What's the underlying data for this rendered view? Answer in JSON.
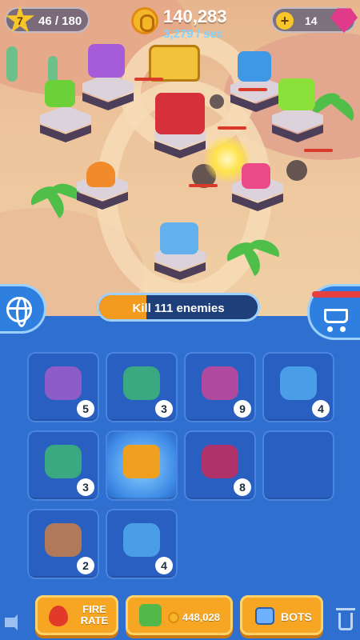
{
  "hud": {
    "level": "7",
    "xp": "46 / 180",
    "coins": "140,283",
    "coin_rate": "3,279 / sec",
    "gems": "14"
  },
  "mission": {
    "label": "Kill 111 enemies",
    "progress": 0.3
  },
  "inventory": [
    {
      "icon": "purple-tank-turret-icon",
      "level": "5",
      "color": "#8e5cc8"
    },
    {
      "icon": "green-cannon-turret-icon",
      "level": "3",
      "color": "#3aa880"
    },
    {
      "icon": "pink-drill-turret-icon",
      "level": "9",
      "color": "#b04aa0"
    },
    {
      "icon": "blue-cannon-turret-icon",
      "level": "4",
      "color": "#4a9ee8"
    },
    {
      "icon": "green-cannon-turret-icon",
      "level": "3",
      "color": "#3aa880"
    },
    {
      "icon": "mystery-crate-icon",
      "level": "",
      "color": "#f0a020"
    },
    {
      "icon": "magenta-twin-turret-icon",
      "level": "8",
      "color": "#b0326a"
    },
    {
      "icon": "",
      "level": "",
      "color": ""
    },
    {
      "icon": "brown-mortar-turret-icon",
      "level": "2",
      "color": "#b07a5a"
    },
    {
      "icon": "blue-cannon-turret-icon",
      "level": "4",
      "color": "#4a9ee8"
    }
  ],
  "buttons": {
    "fire_rate": "FIRE RATE",
    "buy_price": "448,028",
    "bots": "BOTS"
  }
}
